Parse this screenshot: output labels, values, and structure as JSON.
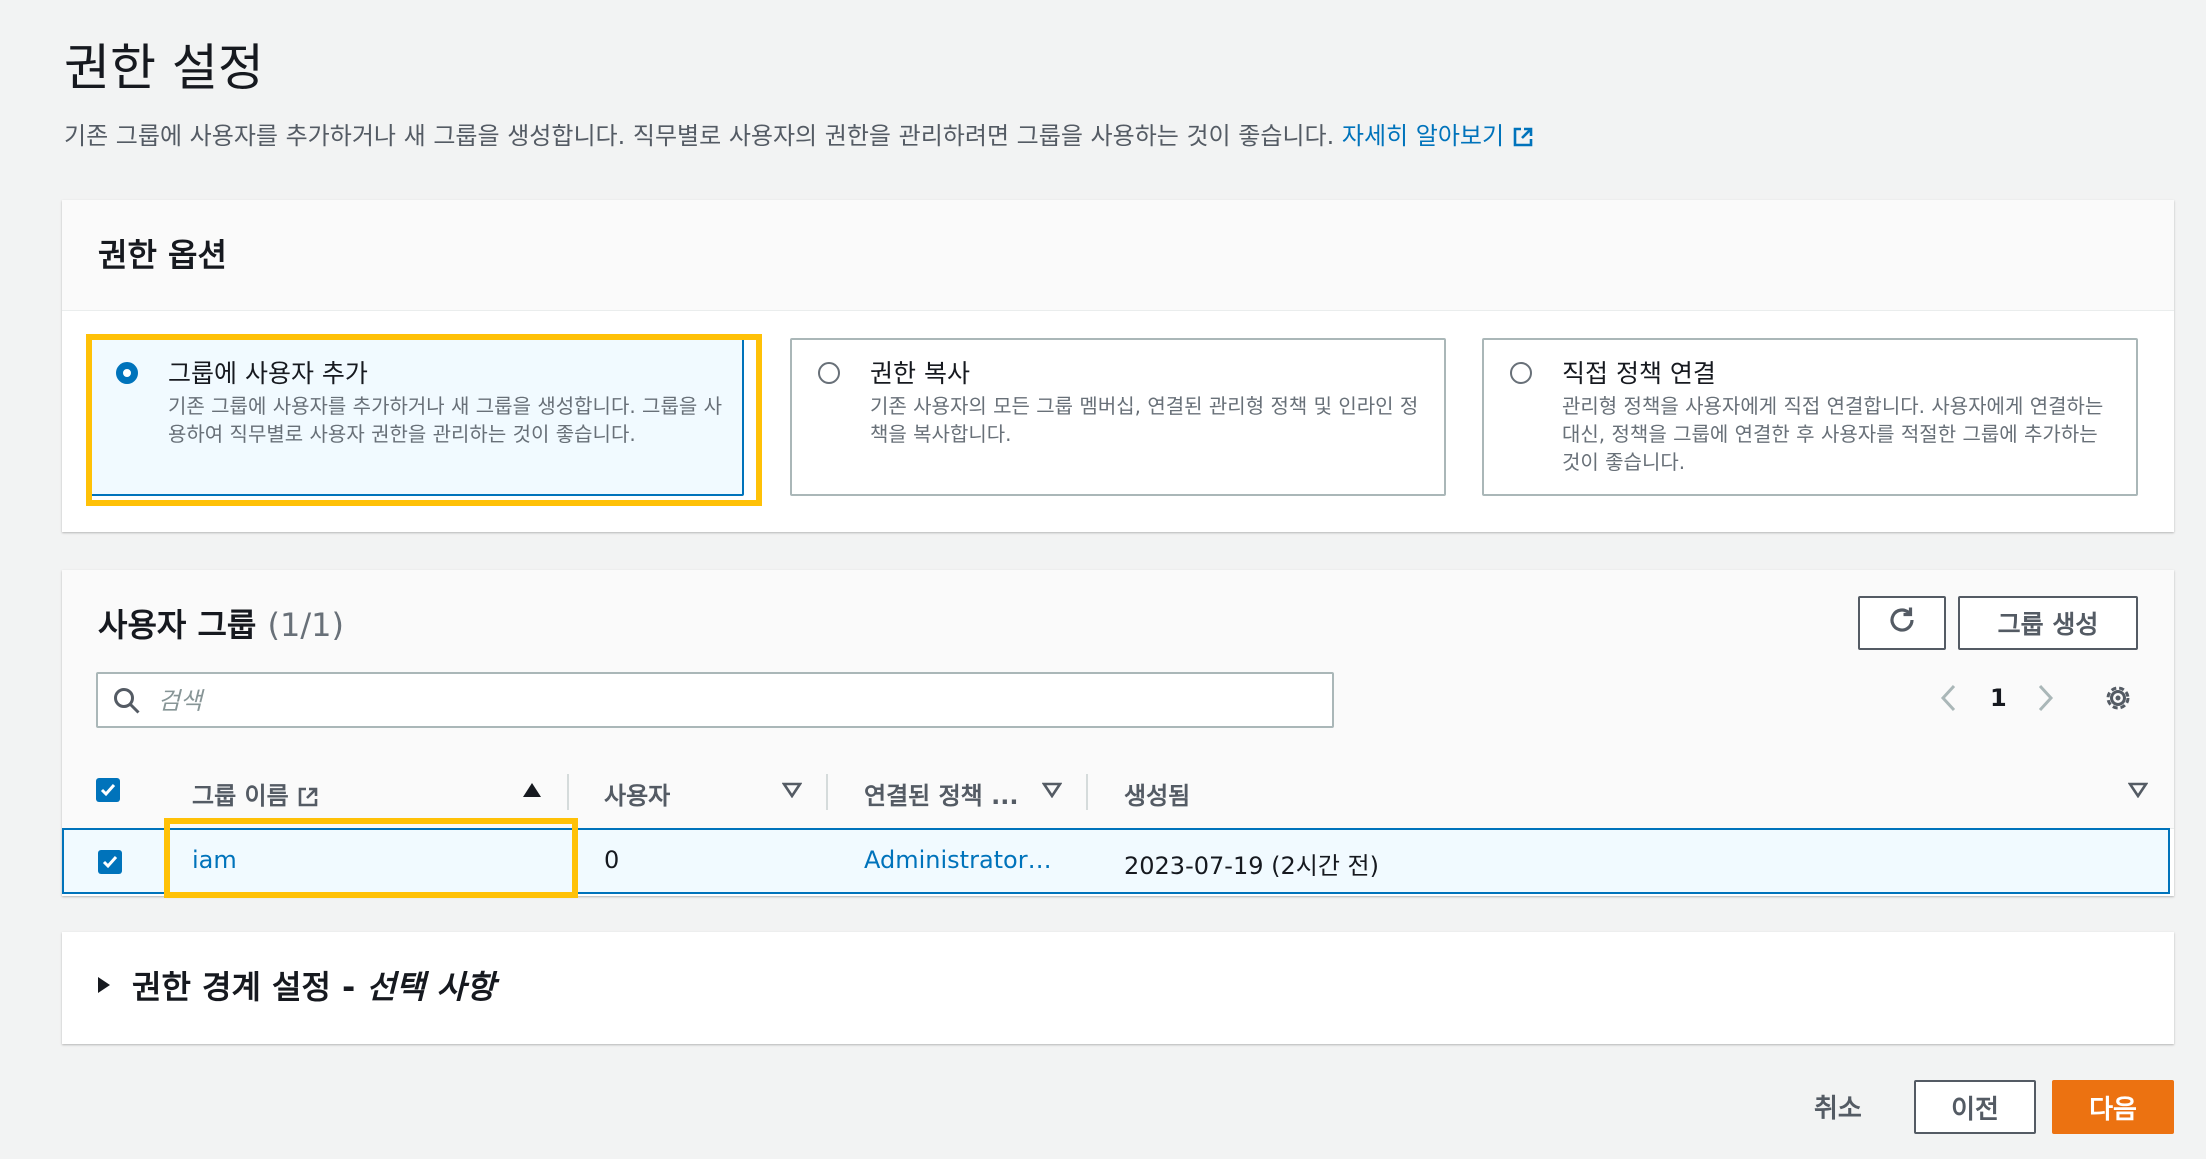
{
  "page": {
    "title": "권한 설정",
    "description": "기존 그룹에 사용자를 추가하거나 새 그룹을 생성합니다. 직무별로 사용자의 권한을 관리하려면 그룹을 사용하는 것이 좋습니다.",
    "learn_more": "자세히 알아보기"
  },
  "permission_options": {
    "heading": "권한 옵션",
    "selected_index": 0,
    "options": [
      {
        "title": "그룹에 사용자 추가",
        "description": "기존 그룹에 사용자를 추가하거나 새 그룹을 생성합니다. 그룹을 사용하여 직무별로 사용자 권한을 관리하는 것이 좋습니다."
      },
      {
        "title": "권한 복사",
        "description": "기존 사용자의 모든 그룹 멤버십, 연결된 관리형 정책 및 인라인 정책을 복사합니다."
      },
      {
        "title": "직접 정책 연결",
        "description": "관리형 정책을 사용자에게 직접 연결합니다. 사용자에게 연결하는 대신, 정책을 그룹에 연결한 후 사용자를 적절한 그룹에 추가하는 것이 좋습니다."
      }
    ]
  },
  "user_groups": {
    "heading": "사용자 그룹",
    "count": "(1/1)",
    "create_group_label": "그룹 생성",
    "search_placeholder": "검색",
    "current_page": "1",
    "columns": [
      "그룹 이름",
      "사용자",
      "연결된 정책 ...",
      "생성됨"
    ],
    "rows": [
      {
        "selected": true,
        "group_name": "iam",
        "users": "0",
        "policies": "Administrator…",
        "created": "2023-07-19 (2시간 전)"
      }
    ]
  },
  "boundary": {
    "title": "권한 경계 설정 - ",
    "optional": "선택 사항"
  },
  "footer": {
    "cancel": "취소",
    "previous": "이전",
    "next": "다음"
  },
  "colors": {
    "accent": "#0073bb",
    "primary_button": "#ec7211",
    "highlight": "#ffc107"
  }
}
